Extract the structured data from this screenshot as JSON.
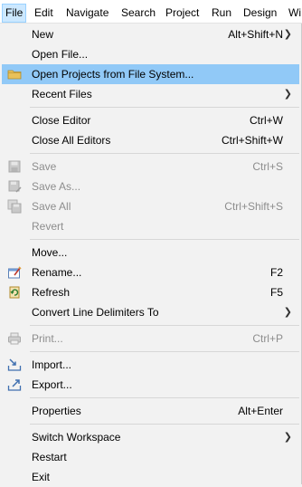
{
  "menubar": {
    "items": [
      {
        "label": "File"
      },
      {
        "label": "Edit"
      },
      {
        "label": "Navigate"
      },
      {
        "label": "Search"
      },
      {
        "label": "Project"
      },
      {
        "label": "Run"
      },
      {
        "label": "Design"
      },
      {
        "label": "Wi"
      }
    ]
  },
  "menu": {
    "items": [
      {
        "label": "New",
        "accelerator": "Alt+Shift+N",
        "submenu": true
      },
      {
        "label": "Open File..."
      },
      {
        "label": "Open Projects from File System...",
        "icon": "folder-icon",
        "highlighted": true
      },
      {
        "label": "Recent Files",
        "submenu": true
      },
      {
        "label": "Close Editor",
        "accelerator": "Ctrl+W"
      },
      {
        "label": "Close All Editors",
        "accelerator": "Ctrl+Shift+W"
      },
      {
        "label": "Save",
        "accelerator": "Ctrl+S",
        "icon": "save-icon",
        "disabled": true
      },
      {
        "label": "Save As...",
        "icon": "save-as-icon",
        "disabled": true
      },
      {
        "label": "Save All",
        "accelerator": "Ctrl+Shift+S",
        "icon": "save-all-icon",
        "disabled": true
      },
      {
        "label": "Revert",
        "disabled": true
      },
      {
        "label": "Move..."
      },
      {
        "label": "Rename...",
        "accelerator": "F2",
        "icon": "rename-icon"
      },
      {
        "label": "Refresh",
        "accelerator": "F5",
        "icon": "refresh-icon"
      },
      {
        "label": "Convert Line Delimiters To",
        "submenu": true
      },
      {
        "label": "Print...",
        "accelerator": "Ctrl+P",
        "icon": "print-icon",
        "disabled": true
      },
      {
        "label": "Import...",
        "icon": "import-icon"
      },
      {
        "label": "Export...",
        "icon": "export-icon"
      },
      {
        "label": "Properties",
        "accelerator": "Alt+Enter"
      },
      {
        "label": "Switch Workspace",
        "submenu": true
      },
      {
        "label": "Restart"
      },
      {
        "label": "Exit"
      }
    ]
  },
  "colors": {
    "highlight": "#91c9f7",
    "menubar_active": "#cce8ff",
    "disabled_text": "#8d8d8d"
  }
}
